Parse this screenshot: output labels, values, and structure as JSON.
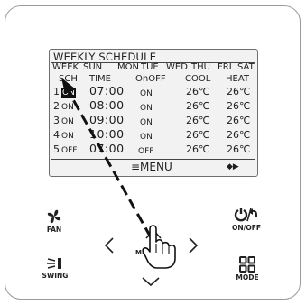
{
  "screen": {
    "title": "WEEKLY SCHEDULE",
    "days": [
      "WEEK",
      "SUN",
      "MON",
      "TUE",
      "WED",
      "THU",
      "FRI",
      "SAT"
    ],
    "columns": [
      "SCH",
      "TIME",
      "OnOFF",
      "COOL",
      "HEAT"
    ],
    "rows": [
      {
        "sch": "1",
        "state": "ON",
        "time": "07:00",
        "onoff": "ON",
        "cool": "26℃",
        "heat": "26℃"
      },
      {
        "sch": "2",
        "state": "ON",
        "time": "08:00",
        "onoff": "ON",
        "cool": "26℃",
        "heat": "26℃"
      },
      {
        "sch": "3",
        "state": "ON",
        "time": "09:00",
        "onoff": "ON",
        "cool": "26℃",
        "heat": "26℃"
      },
      {
        "sch": "4",
        "state": "ON",
        "time": "10:00",
        "onoff": "ON",
        "cool": "26℃",
        "heat": "26℃"
      },
      {
        "sch": "5",
        "state": "OFF",
        "time": "07:00",
        "onoff": "OFF",
        "cool": "26℃",
        "heat": "26℃"
      }
    ],
    "menu_label": "≡MENU",
    "nav_hint": "◆▶"
  },
  "buttons": {
    "fan": "FAN",
    "onoff": "ON/OFF",
    "swing": "SWING",
    "mode": "MODE",
    "menu_ok": "MENU OK"
  },
  "colors": {
    "lcd_bg": "#f2f2f2",
    "ink": "#1e1e1e",
    "highlight": "#111111"
  },
  "icons": [
    "fan-icon",
    "power-back-icon",
    "swing-icon",
    "mode-icon",
    "hand-pointer-icon",
    "chevron-up-icon",
    "chevron-down-icon",
    "chevron-left-icon",
    "chevron-right-icon"
  ]
}
